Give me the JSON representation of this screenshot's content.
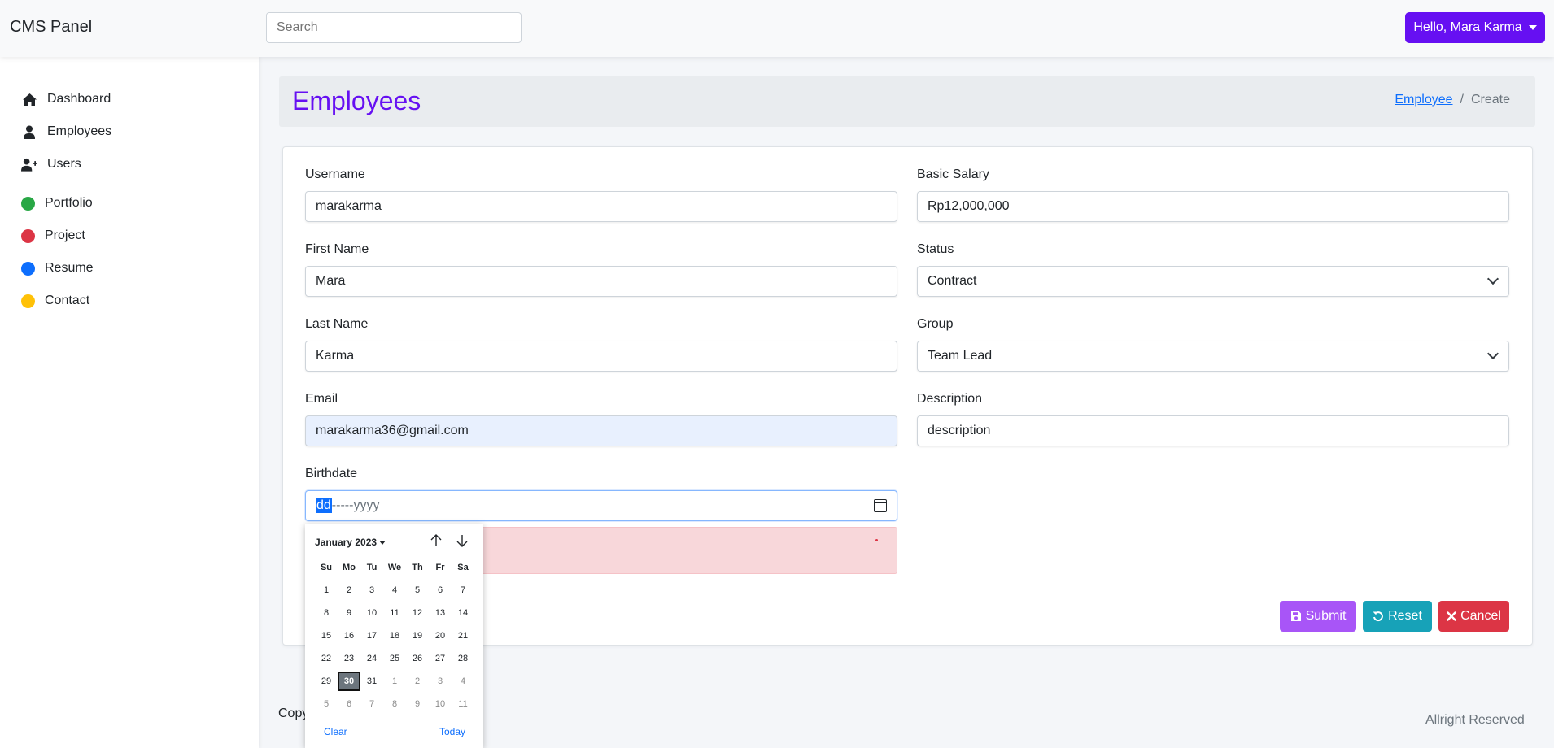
{
  "app": {
    "title": "CMS Panel"
  },
  "search": {
    "placeholder": "Search"
  },
  "user_menu": {
    "label": "Hello, Mara Karma"
  },
  "sidebar": {
    "items": [
      {
        "label": "Dashboard",
        "icon": "home-icon"
      },
      {
        "label": "Employees",
        "icon": "user-tie-icon"
      },
      {
        "label": "Users",
        "icon": "user-plus-icon"
      },
      {
        "label": "Portfolio",
        "icon": "green-dot-icon",
        "color": "#28a745"
      },
      {
        "label": "Project",
        "icon": "red-dot-icon",
        "color": "#dc3545"
      },
      {
        "label": "Resume",
        "icon": "blue-dot-icon",
        "color": "#0d6efd"
      },
      {
        "label": "Contact",
        "icon": "yellow-dot-icon",
        "color": "#ffc107"
      }
    ]
  },
  "page": {
    "title": "Employees",
    "breadcrumb": {
      "link": "Employee",
      "separator": "/",
      "current": "Create"
    }
  },
  "form": {
    "username": {
      "label": "Username",
      "value": "marakarma"
    },
    "first_name": {
      "label": "First Name",
      "value": "Mara"
    },
    "last_name": {
      "label": "Last Name",
      "value": "Karma"
    },
    "email": {
      "label": "Email",
      "value": "marakarma36@gmail.com"
    },
    "birthdate": {
      "label": "Birthdate",
      "selected_part": "dd",
      "rest": "-----yyyy"
    },
    "basic_salary": {
      "label": "Basic Salary",
      "value": "Rp12,000,000"
    },
    "status": {
      "label": "Status",
      "value": "Contract"
    },
    "group": {
      "label": "Group",
      "value": "Team Lead"
    },
    "description": {
      "label": "Description",
      "value": "description"
    }
  },
  "buttons": {
    "submit": "Submit",
    "reset": "Reset",
    "cancel": "Cancel"
  },
  "footer": {
    "left": "Copy",
    "right": "Allright Reserved"
  },
  "datepicker": {
    "month": "January 2023",
    "weekdays": [
      "Su",
      "Mo",
      "Tu",
      "We",
      "Th",
      "Fr",
      "Sa"
    ],
    "weeks": [
      [
        "1",
        "2",
        "3",
        "4",
        "5",
        "6",
        "7"
      ],
      [
        "8",
        "9",
        "10",
        "11",
        "12",
        "13",
        "14"
      ],
      [
        "15",
        "16",
        "17",
        "18",
        "19",
        "20",
        "21"
      ],
      [
        "22",
        "23",
        "24",
        "25",
        "26",
        "27",
        "28"
      ],
      [
        "29",
        "30",
        "31",
        "1",
        "2",
        "3",
        "4"
      ],
      [
        "5",
        "6",
        "7",
        "8",
        "9",
        "10",
        "11"
      ]
    ],
    "selected": "30",
    "clear": "Clear",
    "today": "Today"
  },
  "colors": {
    "accent": "#6610f2",
    "submit": "#a855f7",
    "reset": "#17a2b8",
    "cancel": "#dc3545"
  }
}
